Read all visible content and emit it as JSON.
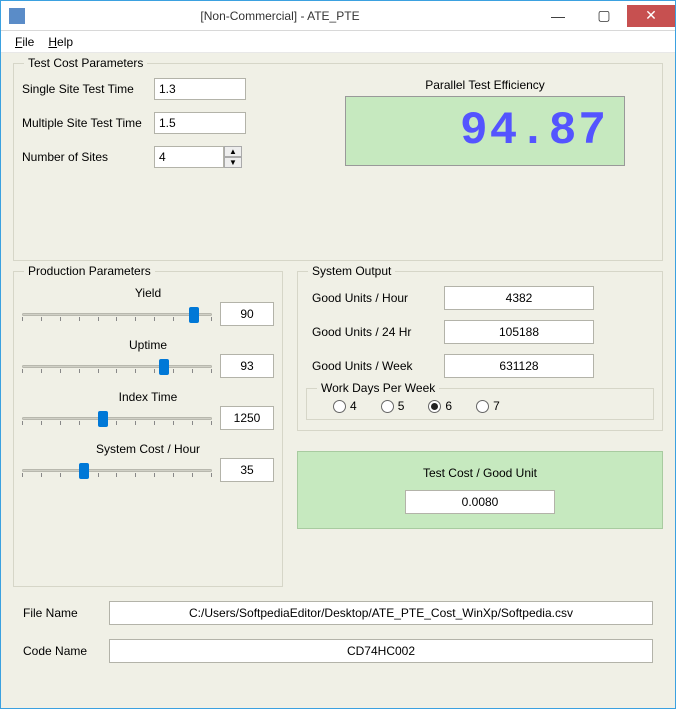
{
  "window": {
    "title": "[Non-Commercial] - ATE_PTE"
  },
  "menu": {
    "file": "File",
    "help": "Help"
  },
  "groups": {
    "test_cost": "Test Cost Parameters",
    "production": "Production Parameters",
    "system_output": "System Output",
    "workdays": "Work Days Per Week"
  },
  "test_cost": {
    "single_label": "Single Site Test Time",
    "single_value": "1.3",
    "multiple_label": "Multiple Site Test Time",
    "multiple_value": "1.5",
    "sites_label": "Number of Sites",
    "sites_value": "4"
  },
  "pte": {
    "label": "Parallel Test Efficiency",
    "value": "94.87"
  },
  "production": {
    "yield": {
      "label": "Yield",
      "value": "90",
      "thumb_pct": 88
    },
    "uptime": {
      "label": "Uptime",
      "value": "93",
      "thumb_pct": 72
    },
    "index": {
      "label": "Index Time",
      "value": "1250",
      "thumb_pct": 40
    },
    "cost": {
      "label": "System Cost / Hour",
      "value": "35",
      "thumb_pct": 30
    }
  },
  "output": {
    "good_hour_label": "Good Units / Hour",
    "good_hour": "4382",
    "good_24_label": "Good Units / 24 Hr",
    "good_24": "105188",
    "good_week_label": "Good Units / Week",
    "good_week": "631128"
  },
  "workdays": {
    "opt4": "4",
    "opt5": "5",
    "opt6": "6",
    "opt7": "7",
    "selected": "6"
  },
  "cost_box": {
    "label": "Test Cost / Good Unit",
    "value": "0.0080"
  },
  "file": {
    "label": "File Name",
    "value": "C:/Users/SoftpediaEditor/Desktop/ATE_PTE_Cost_WinXp/Softpedia.csv"
  },
  "code": {
    "label": "Code Name",
    "value": "CD74HC002"
  }
}
